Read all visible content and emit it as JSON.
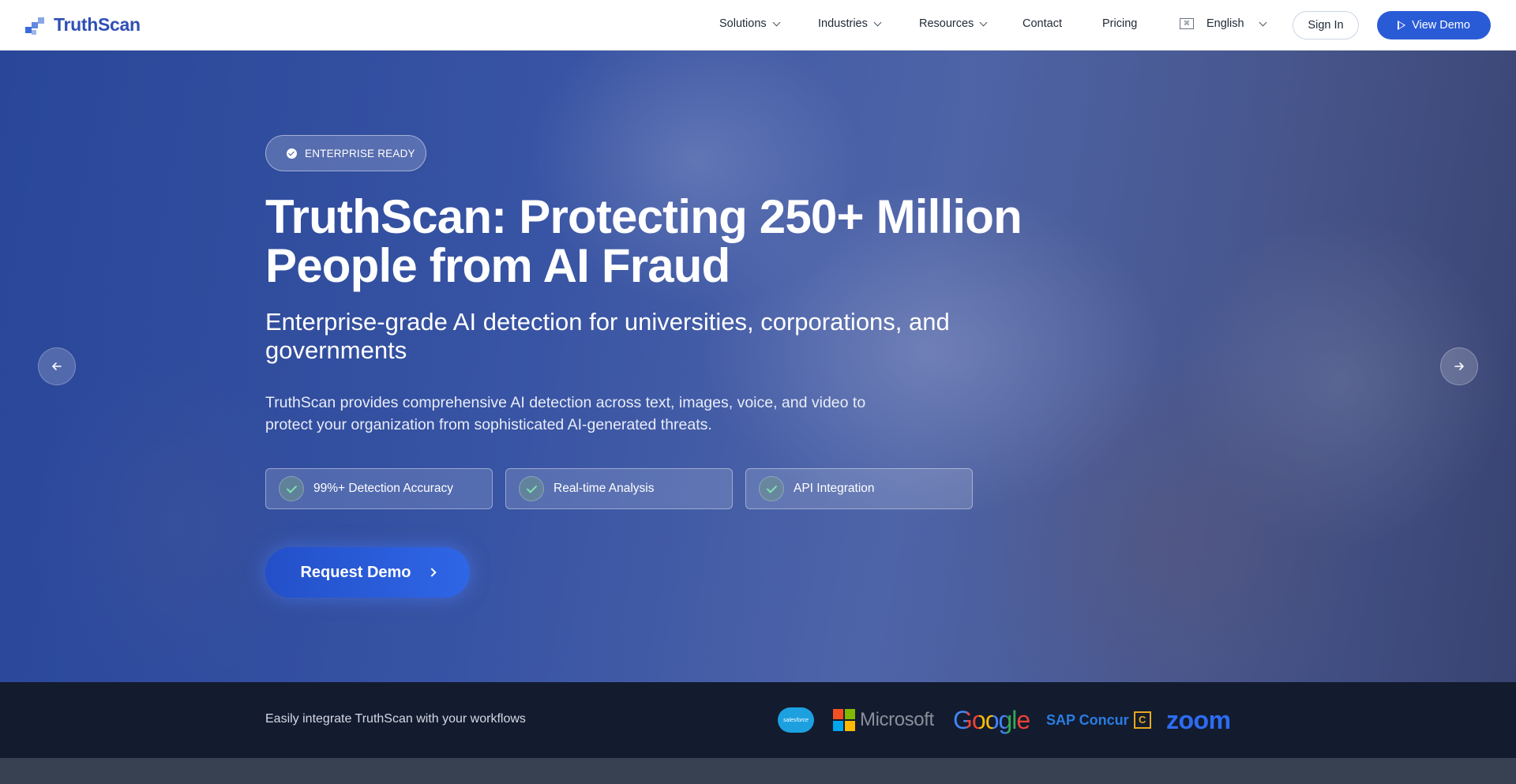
{
  "nav": {
    "logo_text": "TruthScan",
    "items": [
      {
        "label": "Solutions",
        "dropdown": true
      },
      {
        "label": "Industries",
        "dropdown": true
      },
      {
        "label": "Resources",
        "dropdown": true
      },
      {
        "label": "Contact",
        "dropdown": false
      },
      {
        "label": "Pricing",
        "dropdown": false
      }
    ],
    "language": "English",
    "sign_in": "Sign In",
    "view_demo": "View Demo"
  },
  "hero": {
    "badge": "ENTERPRISE READY",
    "title": "TruthScan: Protecting 250+ Million People from AI Fraud",
    "subtitle": "Enterprise-grade AI detection for universities, corporations, and governments",
    "description": "TruthScan provides comprehensive AI detection across text, images, voice, and video to protect your organization from sophisticated AI-generated threats.",
    "features": [
      "99%+ Detection Accuracy",
      "Real-time Analysis",
      "API Integration"
    ],
    "cta": "Request Demo"
  },
  "integrations": {
    "text": "Easily integrate TruthScan with your workflows",
    "partners": [
      "salesforce",
      "Microsoft",
      "Google",
      "SAP Concur",
      "zoom"
    ]
  },
  "colors": {
    "brand": "#2f4fb5",
    "primary_button": "#2a5bd7",
    "strip_bg": "#131b2f",
    "check_color": "#7ee0b0"
  }
}
